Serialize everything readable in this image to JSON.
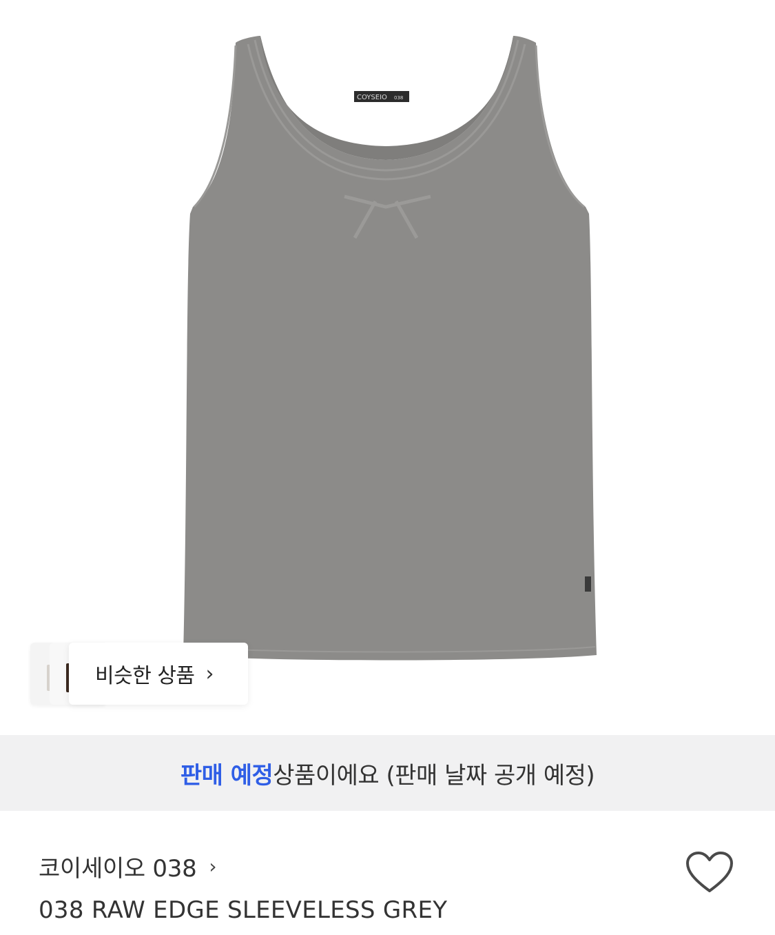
{
  "product_image": {
    "label_text": "COYSEIO",
    "label_sub": "038"
  },
  "similar": {
    "label": "비슷한 상품",
    "chevron": "›"
  },
  "notice": {
    "highlight": "판매 예정",
    "rest": "상품이에요 (판매 날짜 공개 예정)",
    "highlight_color": "#2f5ee6"
  },
  "product": {
    "brand": "코이세이오 038",
    "brand_chevron": "›",
    "name": "038 RAW EDGE SLEEVELESS GREY",
    "wishlist_icon": "heart-icon"
  }
}
